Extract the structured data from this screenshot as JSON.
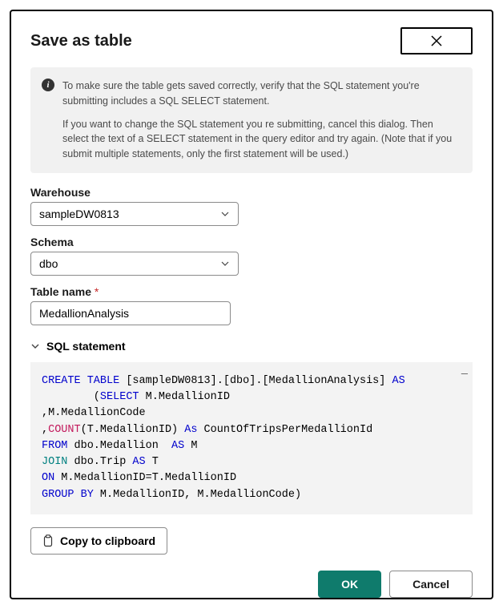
{
  "header": {
    "title": "Save as table"
  },
  "info": {
    "p1": "To make sure the table gets saved correctly, verify that the SQL statement you're submitting includes a SQL SELECT statement.",
    "p2": "If you want to change the SQL statement you re submitting, cancel this dialog. Then select the text of a SELECT statement in the query editor and try again. (Note that if you submit multiple statements, only the first statement will be used.)"
  },
  "fields": {
    "warehouse_label": "Warehouse",
    "warehouse_value": "sampleDW0813",
    "schema_label": "Schema",
    "schema_value": "dbo",
    "tablename_label": "Table name",
    "tablename_value": "MedallionAnalysis"
  },
  "sql": {
    "section_label": "SQL statement",
    "tokens": {
      "create_table": "CREATE TABLE",
      "target": " [sampleDW0813].[dbo].[MedallionAnalysis] ",
      "as": "AS",
      "line2a": "        (",
      "select": "SELECT",
      "line2b": " M.MedallionID",
      "line3": ",M.MedallionCode",
      "line4a": ",",
      "count": "COUNT",
      "line4b": "(T.MedallionID) ",
      "as2": "As",
      "line4c": " CountOfTripsPerMedallionId",
      "from": "FROM",
      "line5": " dbo.Medallion  ",
      "as3": "AS",
      "line5b": " M",
      "join": "JOIN",
      "line6": " dbo.Trip ",
      "as4": "AS",
      "line6b": " T",
      "on": "ON",
      "line7": " M.MedallionID=T.MedallionID",
      "groupby": "GROUP BY",
      "line8": " M.MedallionID, M.MedallionCode)"
    }
  },
  "buttons": {
    "copy": "Copy to clipboard",
    "ok": "OK",
    "cancel": "Cancel"
  }
}
